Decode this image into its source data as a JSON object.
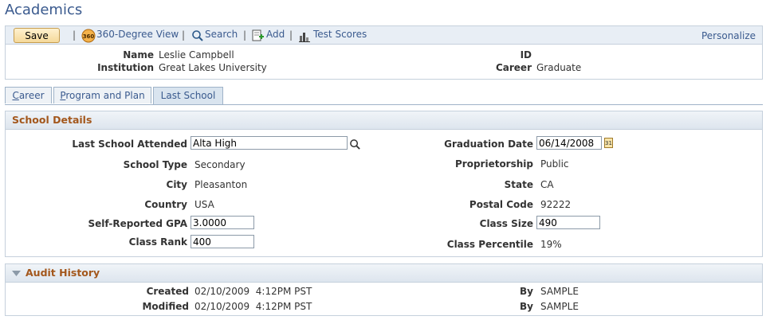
{
  "page": {
    "title": "Academics"
  },
  "toolbar": {
    "save_label": "Save",
    "view360_label": "360-Degree View",
    "search_label": "Search",
    "add_label": "Add",
    "test_scores_label": "Test Scores",
    "personalize_label": "Personalize",
    "separator": "|"
  },
  "header": {
    "name_label": "Name",
    "name_value": "Leslie Campbell",
    "institution_label": "Institution",
    "institution_value": "Great Lakes University",
    "id_label": "ID",
    "id_value": "",
    "career_label": "Career",
    "career_value": "Graduate"
  },
  "tabs": [
    {
      "label": "Career",
      "underline": "C",
      "rest": "areer"
    },
    {
      "label": "Program and Plan",
      "underline": "P",
      "rest": "rogram and Plan"
    },
    {
      "label": "Last School"
    }
  ],
  "school_details": {
    "title": "School Details",
    "last_school_label": "Last School Attended",
    "last_school_value": "Alta High",
    "graduation_date_label": "Graduation Date",
    "graduation_date_value": "06/14/2008",
    "calendar_icon_text": "31",
    "school_type_label": "School Type",
    "school_type_value": "Secondary",
    "proprietorship_label": "Proprietorship",
    "proprietorship_value": "Public",
    "city_label": "City",
    "city_value": "Pleasanton",
    "state_label": "State",
    "state_value": "CA",
    "country_label": "Country",
    "country_value": "USA",
    "postal_code_label": "Postal Code",
    "postal_code_value": "92222",
    "gpa_label": "Self-Reported GPA",
    "gpa_value": "3.0000",
    "class_size_label": "Class Size",
    "class_size_value": "490",
    "class_rank_label": "Class Rank",
    "class_rank_value": "400",
    "class_percentile_label": "Class Percentile",
    "class_percentile_value": "19%"
  },
  "audit": {
    "title": "Audit History",
    "created_label": "Created",
    "created_value": "02/10/2009  4:12PM PST",
    "modified_label": "Modified",
    "modified_value": "02/10/2009  4:12PM PST",
    "by_label": "By",
    "created_by": "SAMPLE",
    "modified_by": "SAMPLE"
  }
}
